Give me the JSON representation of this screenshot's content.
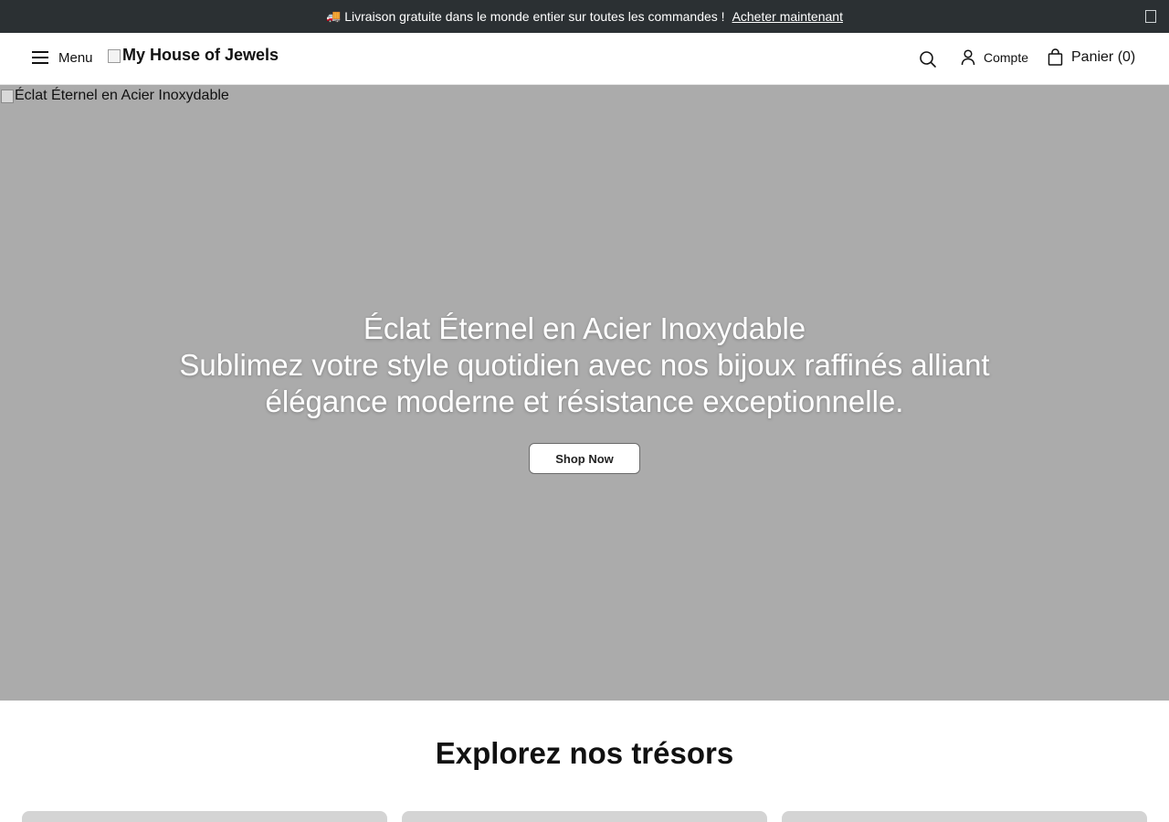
{
  "announcement": {
    "text": "Livraison gratuite dans le monde entier sur toutes les commandes !",
    "link_label": "Acheter maintenant",
    "icon": "truck-icon"
  },
  "header": {
    "menu_label": "Menu",
    "logo_alt": "My House of Jewels",
    "account_label": "Compte",
    "cart_label": "Panier (0)"
  },
  "hero": {
    "image_alt": "Éclat Éternel en Acier Inoxydable",
    "title": "Éclat Éternel en Acier Inoxydable",
    "subtitle": "Sublimez votre style quotidien avec nos bijoux raffinés alliant élégance moderne et résistance exceptionnelle.",
    "cta_label": "Shop Now"
  },
  "collections": {
    "title": "Explorez nos trésors"
  },
  "colors": {
    "announcement_bg": "#2b3033",
    "hero_bg": "#ababab"
  }
}
